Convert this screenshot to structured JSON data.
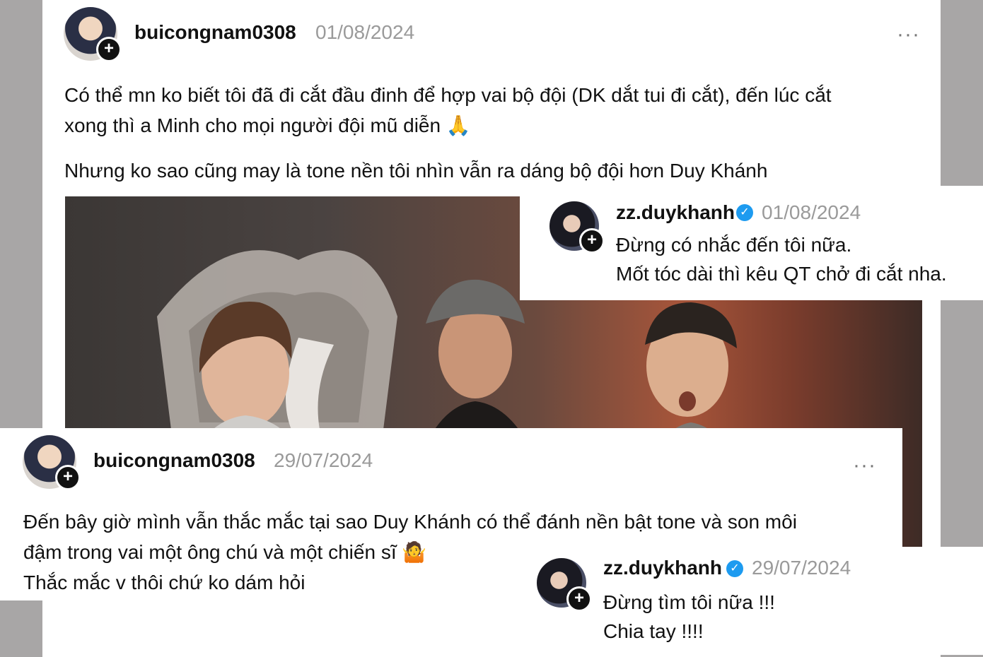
{
  "post1": {
    "username": "buicongnam0308",
    "date": "01/08/2024",
    "menu_icon": "more-dots-icon",
    "line1": "Có thể mn ko biết tôi đã đi cắt đầu đinh để hợp vai bộ đội (DK dắt tui đi cắt), đến lúc cắt",
    "line2": "xong thì a Minh cho mọi người đội mũ diễn",
    "line2_emoji": "🙏",
    "line3": "Nhưng ko sao cũng may là tone nền tôi nhìn vẫn ra dáng bộ đội hơn Duy Khánh"
  },
  "reply1": {
    "username": "zz.duykhanh",
    "verified_icon": "verified-badge-icon",
    "date": "01/08/2024",
    "line1": "Đừng có nhắc đến tôi nữa.",
    "line2": "Mốt tóc dài thì kêu QT chở đi cắt nha."
  },
  "post2": {
    "username": "buicongnam0308",
    "date": "29/07/2024",
    "menu_icon": "more-dots-icon",
    "line1": "Đến bây giờ mình vẫn thắc mắc tại sao Duy Khánh có thể đánh nền bật tone và son môi",
    "line2": "đậm trong vai một ông chú và một chiến sĩ",
    "line2_emoji": "🤷",
    "line3": "Thắc mắc v thôi chứ ko dám hỏi"
  },
  "reply2": {
    "username": "zz.duykhanh",
    "verified_icon": "verified-badge-icon",
    "date": "29/07/2024",
    "line1": "Đừng tìm tôi nữa !!!",
    "line2": "Chia tay !!!!"
  },
  "plus_symbol": "+",
  "dots_symbol": "···",
  "check_symbol": "✓"
}
